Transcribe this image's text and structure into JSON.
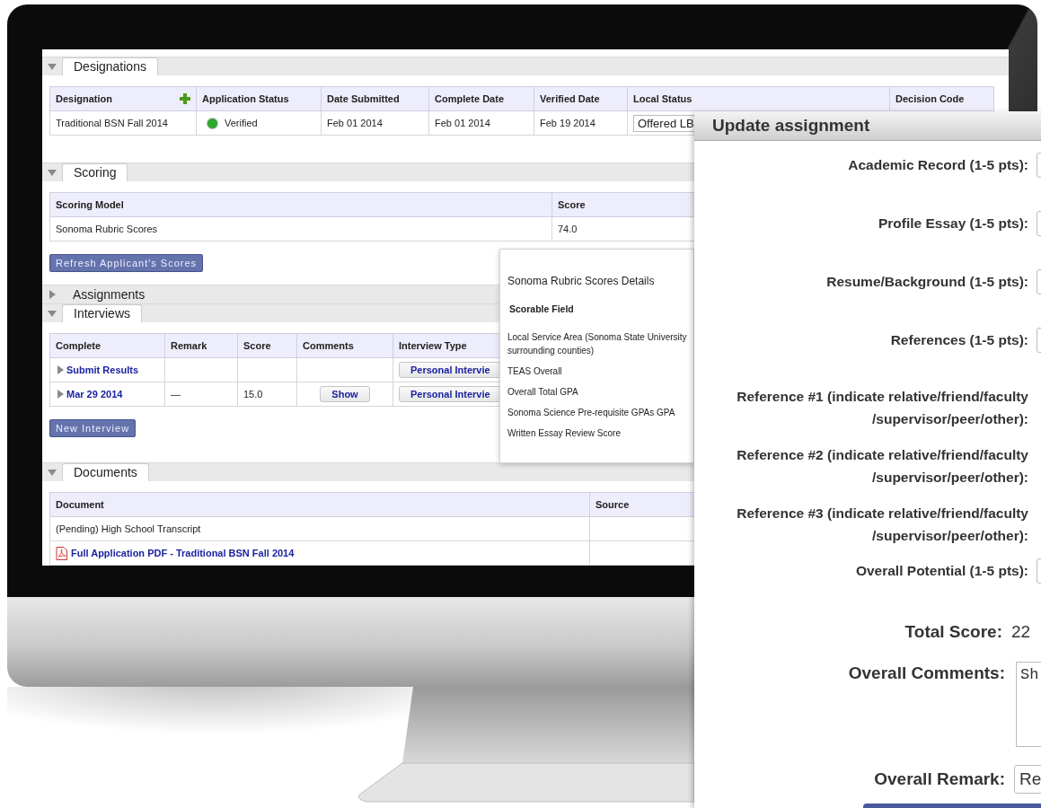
{
  "designations": {
    "title": "Designations",
    "expanded": true,
    "columns": [
      "Designation",
      "Application Status",
      "Date Submitted",
      "Complete Date",
      "Verified Date",
      "Local Status",
      "Decision Code"
    ],
    "rows": [
      {
        "designation": "Traditional BSN Fall 2014",
        "status": "Verified",
        "color": "#2fa82f",
        "submitted": "Feb 01 2014",
        "complete": "Feb 01 2014",
        "verified": "Feb 19 2014",
        "local_status": "Offered LB"
      }
    ]
  },
  "scoring": {
    "title": "Scoring",
    "expanded": true,
    "columns": [
      "Scoring Model",
      "Score"
    ],
    "rows": [
      {
        "model": "Sonoma Rubric Scores",
        "score": "74.0"
      }
    ],
    "button": "Refresh Applicant's Scores"
  },
  "assignments": {
    "title": "Assignments",
    "expanded": false
  },
  "interviews": {
    "title": "Interviews",
    "expanded": true,
    "columns": [
      "Complete",
      "Remark",
      "Score",
      "Comments",
      "Interview Type"
    ],
    "rows": [
      {
        "expanded": false,
        "complete": "Submit Results",
        "interview_type": "Personal Intervie"
      },
      {
        "expanded": false,
        "complete": "Mar 29 2014",
        "remark": "—",
        "score": "15.0",
        "comments": "Show",
        "interview_type": "Personal Intervie"
      }
    ],
    "button": "New Interview"
  },
  "documents": {
    "title": "Documents",
    "expanded": true,
    "columns": [
      "Document",
      "Source"
    ],
    "rows": [
      {
        "kind": "pending",
        "name": "(Pending) High School Transcript"
      },
      {
        "kind": "pdf_link",
        "name": "Full Application PDF - Traditional BSN Fall 2014"
      }
    ]
  },
  "popover": {
    "title": "Sonoma Rubric Scores Details",
    "heading": "Scorable Field",
    "items": [
      "Local Service Area (Sonoma State University surrounding counties)",
      "TEAS Overall",
      "Overall Total GPA",
      "Sonoma Science Pre-requisite GPAs GPA",
      "Written Essay Review Score"
    ]
  },
  "dialog": {
    "title": "Update assignment",
    "fields": [
      {
        "kind": "score",
        "label": "Academic Record (1-5 pts):"
      },
      {
        "kind": "score",
        "label": "Profile Essay (1-5 pts):"
      },
      {
        "kind": "score",
        "label": "Resume/Background (1-5 pts):"
      },
      {
        "kind": "score",
        "label": "References (1-5 pts):"
      },
      {
        "kind": "reference",
        "label": "Reference #1 (indicate relative/friend/faculty /supervisor/peer/other):"
      },
      {
        "kind": "reference",
        "label": "Reference #2 (indicate relative/friend/faculty /supervisor/peer/other):"
      },
      {
        "kind": "reference",
        "label": "Reference #3 (indicate relative/friend/faculty /supervisor/peer/other):"
      },
      {
        "kind": "score",
        "label": "Overall Potential (1-5 pts):"
      }
    ],
    "total_label": "Total Score:",
    "total_value": "22",
    "comments_label": "Overall Comments:",
    "comments_value": "Sh",
    "remark_label": "Overall Remark:",
    "remark_value": "Re"
  }
}
